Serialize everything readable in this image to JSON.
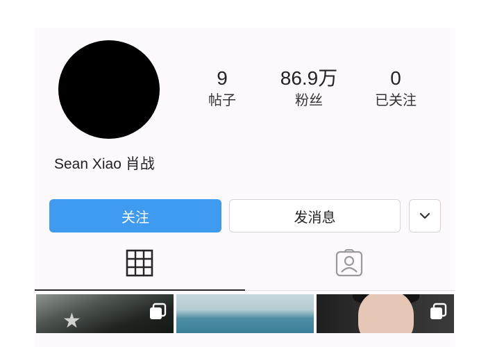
{
  "profile": {
    "username": "Sean Xiao 肖战"
  },
  "stats": {
    "posts": {
      "value": "9",
      "label": "帖子"
    },
    "followers": {
      "value": "86.9万",
      "label": "粉丝"
    },
    "following": {
      "value": "0",
      "label": "已关注"
    }
  },
  "actions": {
    "follow_label": "关注",
    "message_label": "发消息",
    "more_icon": "chevron-down-icon"
  },
  "tabs": {
    "grid_icon": "grid-icon",
    "tagged_icon": "tagged-user-icon",
    "active": "grid"
  },
  "thumbnails": [
    {
      "icon": "multiple-posts-icon"
    },
    {
      "icon": ""
    },
    {
      "icon": "multiple-posts-icon"
    }
  ],
  "colors": {
    "follow_button": "#3f9bf0",
    "avatar": "#000000"
  }
}
